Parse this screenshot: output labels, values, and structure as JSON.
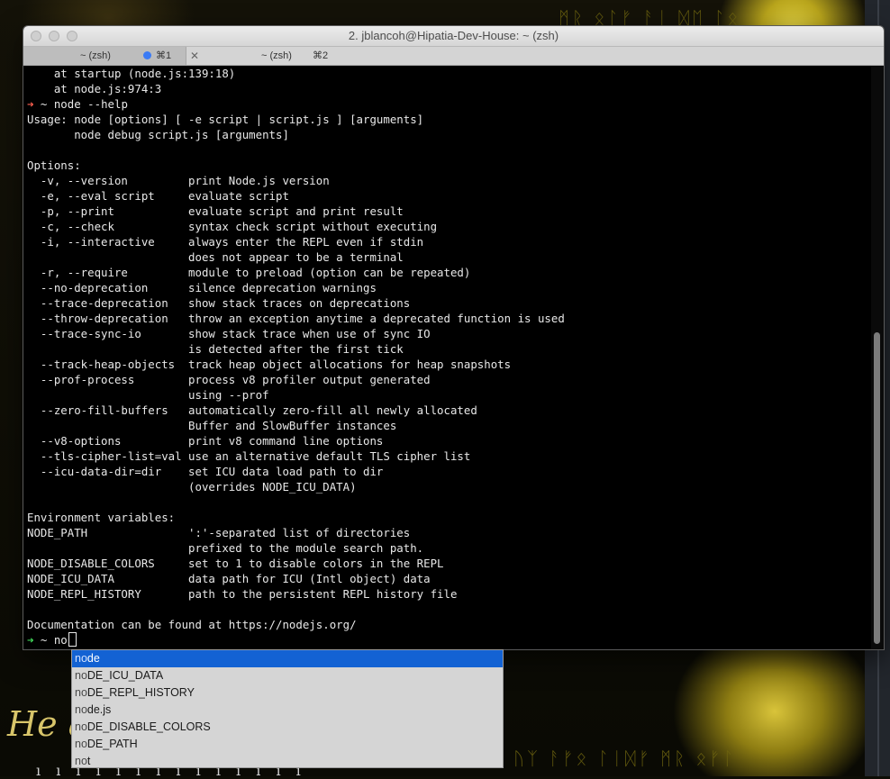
{
  "window": {
    "title": "2. jblancoh@Hipatia-Dev-House: ~ (zsh)",
    "tabs": [
      {
        "label": "~ (zsh)",
        "shortcut": "⌘1",
        "active": false
      },
      {
        "label": "~ (zsh)",
        "shortcut": "⌘2",
        "active": true
      }
    ]
  },
  "terminal": {
    "lines": [
      {
        "prefix": "",
        "text": "    at startup (node.js:139:18)"
      },
      {
        "prefix": "",
        "text": "    at node.js:974:3"
      },
      {
        "prefix": "➜",
        "prefix_color": "red",
        "text": " ~ node --help"
      },
      {
        "prefix": "",
        "text": "Usage: node [options] [ -e script | script.js ] [arguments]"
      },
      {
        "prefix": "",
        "text": "       node debug script.js [arguments]"
      },
      {
        "prefix": "",
        "text": ""
      },
      {
        "prefix": "",
        "text": "Options:"
      },
      {
        "prefix": "",
        "text": "  -v, --version         print Node.js version"
      },
      {
        "prefix": "",
        "text": "  -e, --eval script     evaluate script"
      },
      {
        "prefix": "",
        "text": "  -p, --print           evaluate script and print result"
      },
      {
        "prefix": "",
        "text": "  -c, --check           syntax check script without executing"
      },
      {
        "prefix": "",
        "text": "  -i, --interactive     always enter the REPL even if stdin"
      },
      {
        "prefix": "",
        "text": "                        does not appear to be a terminal"
      },
      {
        "prefix": "",
        "text": "  -r, --require         module to preload (option can be repeated)"
      },
      {
        "prefix": "",
        "text": "  --no-deprecation      silence deprecation warnings"
      },
      {
        "prefix": "",
        "text": "  --trace-deprecation   show stack traces on deprecations"
      },
      {
        "prefix": "",
        "text": "  --throw-deprecation   throw an exception anytime a deprecated function is used"
      },
      {
        "prefix": "",
        "text": "  --trace-sync-io       show stack trace when use of sync IO"
      },
      {
        "prefix": "",
        "text": "                        is detected after the first tick"
      },
      {
        "prefix": "",
        "text": "  --track-heap-objects  track heap object allocations for heap snapshots"
      },
      {
        "prefix": "",
        "text": "  --prof-process        process v8 profiler output generated"
      },
      {
        "prefix": "",
        "text": "                        using --prof"
      },
      {
        "prefix": "",
        "text": "  --zero-fill-buffers   automatically zero-fill all newly allocated"
      },
      {
        "prefix": "",
        "text": "                        Buffer and SlowBuffer instances"
      },
      {
        "prefix": "",
        "text": "  --v8-options          print v8 command line options"
      },
      {
        "prefix": "",
        "text": "  --tls-cipher-list=val use an alternative default TLS cipher list"
      },
      {
        "prefix": "",
        "text": "  --icu-data-dir=dir    set ICU data load path to dir"
      },
      {
        "prefix": "",
        "text": "                        (overrides NODE_ICU_DATA)"
      },
      {
        "prefix": "",
        "text": ""
      },
      {
        "prefix": "",
        "text": "Environment variables:"
      },
      {
        "prefix": "",
        "text": "NODE_PATH               ':'-separated list of directories"
      },
      {
        "prefix": "",
        "text": "                        prefixed to the module search path."
      },
      {
        "prefix": "",
        "text": "NODE_DISABLE_COLORS     set to 1 to disable colors in the REPL"
      },
      {
        "prefix": "",
        "text": "NODE_ICU_DATA           data path for ICU (Intl object) data"
      },
      {
        "prefix": "",
        "text": "NODE_REPL_HISTORY       path to the persistent REPL history file"
      },
      {
        "prefix": "",
        "text": ""
      },
      {
        "prefix": "",
        "text": "Documentation can be found at https://nodejs.org/"
      }
    ],
    "prompt": {
      "arrow": "➜",
      "text": " ~ no"
    }
  },
  "autocomplete": {
    "typed": "no",
    "items": [
      {
        "match": "no",
        "rest": "de",
        "selected": true
      },
      {
        "match": "no",
        "rest": "DE_ICU_DATA",
        "selected": false
      },
      {
        "match": "no",
        "rest": "DE_REPL_HISTORY",
        "selected": false
      },
      {
        "match": "no",
        "rest": "de.js",
        "selected": false
      },
      {
        "match": "no",
        "rest": "DE_DISABLE_COLORS",
        "selected": false
      },
      {
        "match": "no",
        "rest": "DE_PATH",
        "selected": false
      },
      {
        "match": "no",
        "rest": "t",
        "selected": false
      }
    ]
  },
  "background": {
    "script_text": "He a",
    "glyphs_top": "ᛗᚱ ᛟᛚᚠ ᚨᛁ ᛞᛖ ᛚᛟ",
    "glyphs_bottom": "ᚢᛉ ᚨᚠᛟ ᛚᛁᛞᚠ ᛗᚱ ᛟᚠᛚ",
    "bottom_text": "ı ı ı ı ı ı ı ı ı ı ı ı ı ı"
  },
  "colors": {
    "prompt_red": "#ff5f4f",
    "prompt_green": "#41d95a",
    "selection_blue": "#1362d3"
  }
}
